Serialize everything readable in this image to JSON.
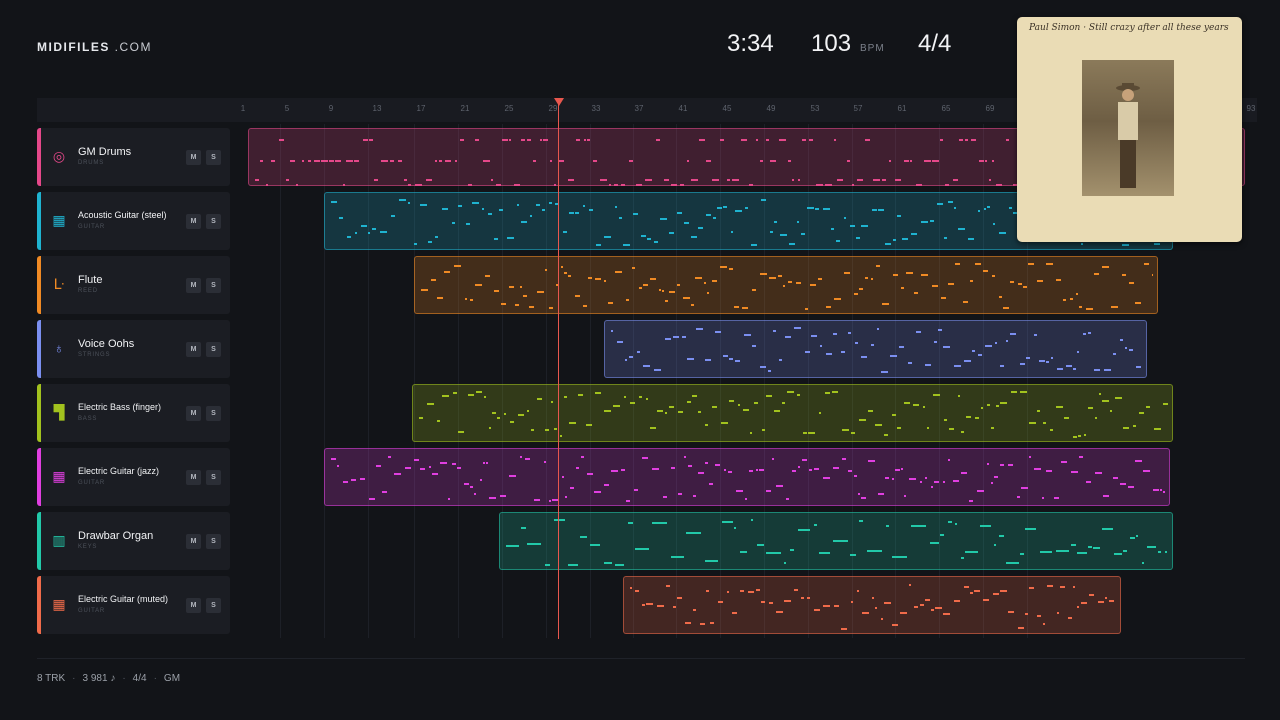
{
  "brand": {
    "name": "MIDIFILES",
    "suffix": " .COM"
  },
  "transport": {
    "time": "3:34",
    "bpm": "103",
    "bpm_unit": "BPM",
    "signature": "4/4"
  },
  "ruler": [
    "1",
    "5",
    "9",
    "13",
    "17",
    "21",
    "25",
    "29",
    "33",
    "37",
    "41",
    "45",
    "49",
    "53",
    "57",
    "61",
    "65",
    "69",
    "93"
  ],
  "buttons": {
    "mute": "M",
    "solo": "S"
  },
  "tracks": [
    {
      "name": "GM Drums",
      "category": "DRUMS",
      "color": "#e5488a",
      "icon": "drum-icon",
      "glyph": "◎"
    },
    {
      "name": "Acoustic Guitar (steel)",
      "category": "GUITAR",
      "color": "#1fb3d0",
      "icon": "guitar-icon",
      "glyph": "▦"
    },
    {
      "name": "Flute",
      "category": "REED",
      "color": "#f08a24",
      "icon": "flute-icon",
      "glyph": "ᒷ"
    },
    {
      "name": "Voice Oohs",
      "category": "STRINGS",
      "color": "#7b8ff0",
      "icon": "violin-icon",
      "glyph": "♁"
    },
    {
      "name": "Electric Bass (finger)",
      "category": "BASS",
      "color": "#a2c21e",
      "icon": "bass-amp-icon",
      "glyph": "▜"
    },
    {
      "name": "Electric Guitar (jazz)",
      "category": "GUITAR",
      "color": "#e03fe0",
      "icon": "guitar-icon",
      "glyph": "▦"
    },
    {
      "name": "Drawbar Organ",
      "category": "KEYS",
      "color": "#22c9a9",
      "icon": "piano-icon",
      "glyph": "▥"
    },
    {
      "name": "Electric Guitar (muted)",
      "category": "GUITAR",
      "color": "#f06b4a",
      "icon": "guitar-icon",
      "glyph": "▦"
    }
  ],
  "album": {
    "handwriting": "Paul Simon · Still crazy after all these years"
  },
  "footer": {
    "tracks": "8 TRK",
    "notes": "3 981 ♪",
    "signature": "4/4",
    "standard": "GM"
  }
}
